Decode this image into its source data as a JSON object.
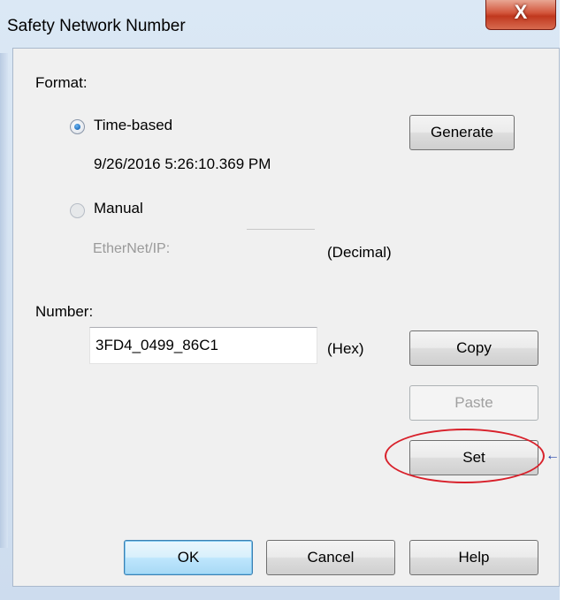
{
  "window": {
    "title": "Safety Network Number",
    "close_glyph": "X"
  },
  "format": {
    "label": "Format:",
    "time_based": {
      "label": "Time-based",
      "selected": true,
      "value": "9/26/2016 5:26:10.369 PM"
    },
    "manual": {
      "label": "Manual",
      "selected": false
    },
    "ethernet_label": "EtherNet/IP:",
    "ethernet_value": "",
    "decimal_label": "(Decimal)",
    "generate_label": "Generate"
  },
  "number": {
    "label": "Number:",
    "value": "3FD4_0499_86C1",
    "hex_label": "(Hex)",
    "copy_label": "Copy",
    "paste_label": "Paste",
    "set_label": "Set"
  },
  "footer": {
    "ok_label": "OK",
    "cancel_label": "Cancel",
    "help_label": "Help"
  },
  "annotation": {
    "color": "#d8202a",
    "arrow_glyph": "←"
  }
}
